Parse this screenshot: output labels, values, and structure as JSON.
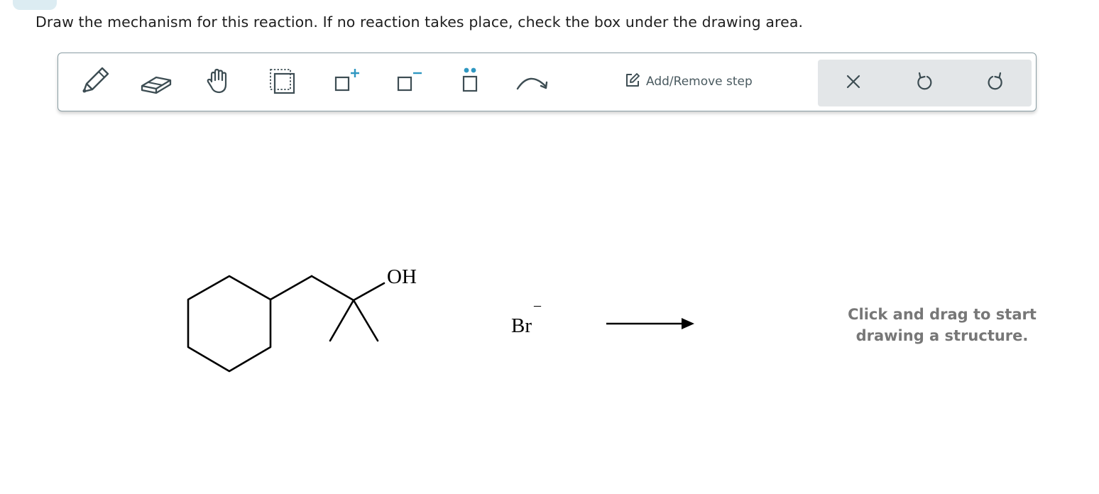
{
  "prompt": "Draw the mechanism for this reaction. If no reaction takes place, check the box under the drawing area.",
  "toolbar": {
    "tools": [
      {
        "name": "pencil-icon"
      },
      {
        "name": "eraser-icon"
      },
      {
        "name": "hand-icon"
      },
      {
        "name": "select-box-icon"
      },
      {
        "name": "add-positive-charge-icon"
      },
      {
        "name": "add-negative-charge-icon"
      },
      {
        "name": "lone-pair-icon"
      },
      {
        "name": "curved-arrow-icon"
      }
    ],
    "step_label": "Add/Remove step",
    "actions": [
      {
        "name": "clear-icon"
      },
      {
        "name": "undo-icon"
      },
      {
        "name": "redo-icon"
      }
    ]
  },
  "reaction": {
    "reactant_label": "OH",
    "reagent_label": "Br",
    "reagent_charge": "–"
  },
  "canvas_hint_line1": "Click and drag to start",
  "canvas_hint_line2": "drawing a structure.",
  "colors": {
    "icon": "#3d4d53",
    "accent": "#2f97c1",
    "action_bg": "#e3e6e8",
    "hint": "#777777"
  }
}
